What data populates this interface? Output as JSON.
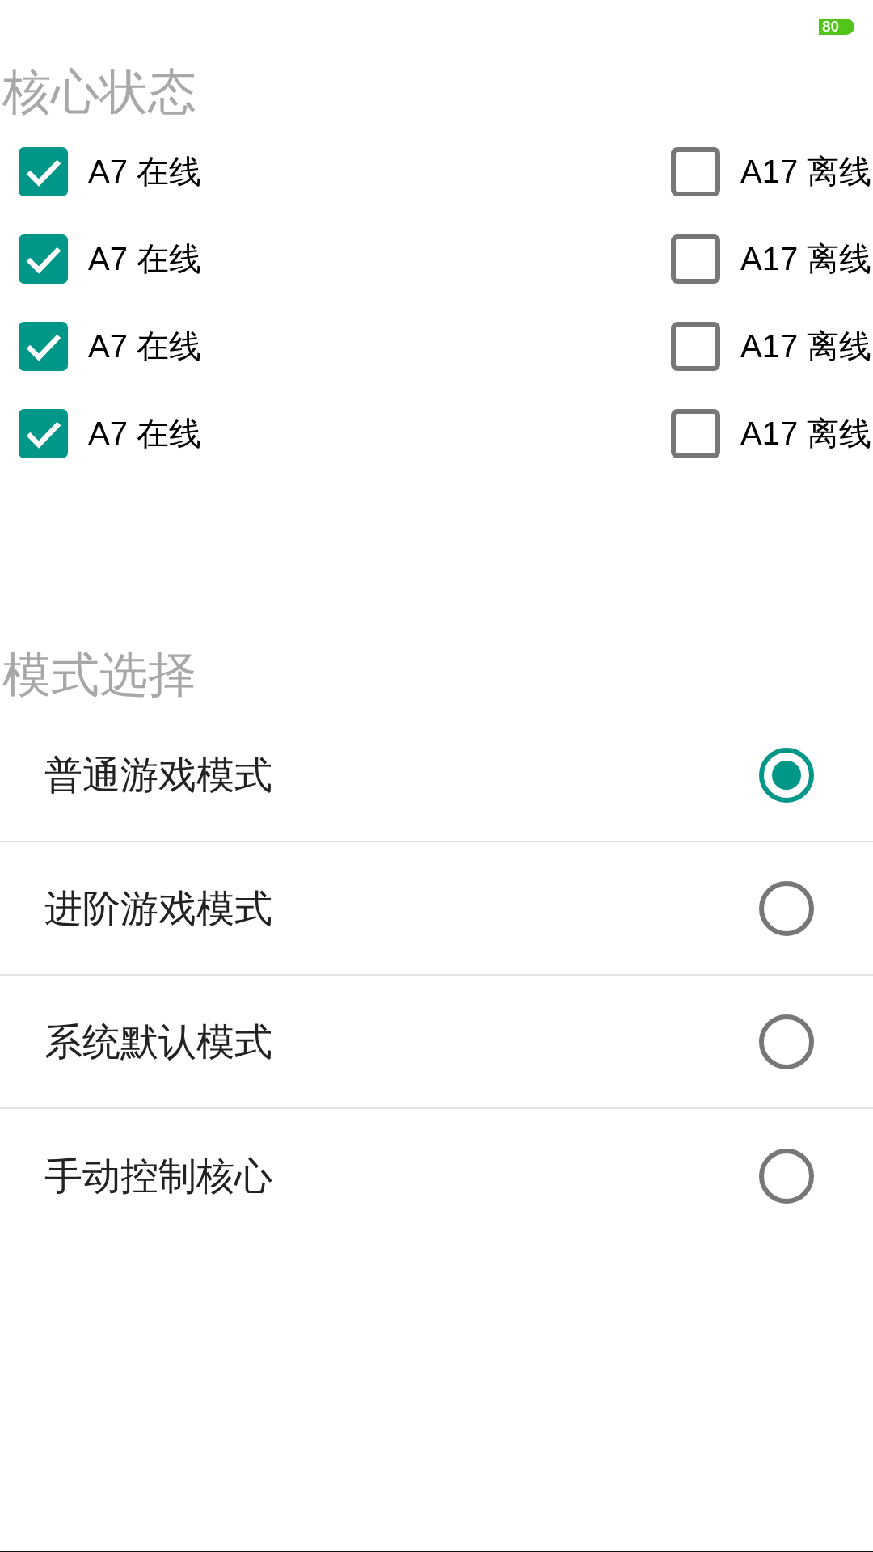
{
  "status_bar": {
    "battery": "80"
  },
  "core_status": {
    "title": "核心状态",
    "cores": [
      {
        "label": "A7 在线",
        "checked": true
      },
      {
        "label": "A17 离线",
        "checked": false
      },
      {
        "label": "A7 在线",
        "checked": true
      },
      {
        "label": "A17 离线",
        "checked": false
      },
      {
        "label": "A7 在线",
        "checked": true
      },
      {
        "label": "A17 离线",
        "checked": false
      },
      {
        "label": "A7 在线",
        "checked": true
      },
      {
        "label": "A17 离线",
        "checked": false
      }
    ]
  },
  "mode_select": {
    "title": "模式选择",
    "modes": [
      {
        "label": "普通游戏模式",
        "selected": true
      },
      {
        "label": "进阶游戏模式",
        "selected": false
      },
      {
        "label": "系统默认模式",
        "selected": false
      },
      {
        "label": "手动控制核心",
        "selected": false
      }
    ]
  }
}
